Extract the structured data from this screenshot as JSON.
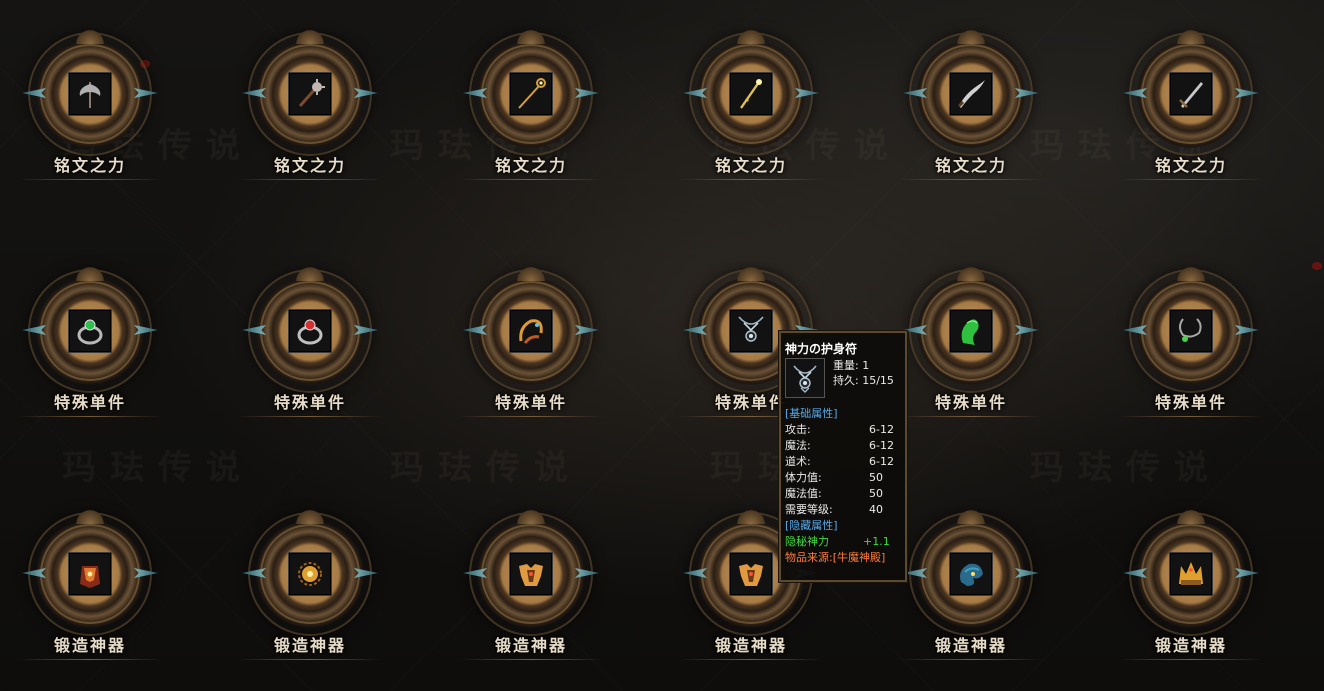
{
  "watermark_text": "玛珐传说",
  "rows": [
    {
      "label": "铭文之力",
      "items": [
        {
          "icon": "double-axe-icon",
          "color": "#b0b0b0"
        },
        {
          "icon": "spiked-mace-icon",
          "color": "#c0b8b0"
        },
        {
          "icon": "golden-staff-icon",
          "color": "#d7a13a"
        },
        {
          "icon": "golden-wand-icon",
          "color": "#e0c050"
        },
        {
          "icon": "curved-blade-icon",
          "color": "#d0d0d0"
        },
        {
          "icon": "long-sword-icon",
          "color": "#c8c8c8"
        }
      ]
    },
    {
      "label": "特殊单件",
      "items": [
        {
          "icon": "green-gem-ring-icon",
          "color": "#2fbf4f"
        },
        {
          "icon": "red-gem-ring-icon",
          "color": "#d83030"
        },
        {
          "icon": "golden-bracelet-icon",
          "color": "#e09a30"
        },
        {
          "icon": "amulet-icon",
          "color": "#9fb8c8"
        },
        {
          "icon": "green-jade-icon",
          "color": "#30c040"
        },
        {
          "icon": "green-necklace-icon",
          "color": "#4ad04a"
        }
      ]
    },
    {
      "label": "锻造神器",
      "items": [
        {
          "icon": "red-gold-armor-icon",
          "color": "#e07a30"
        },
        {
          "icon": "sun-medallion-icon",
          "color": "#e0a030"
        },
        {
          "icon": "golden-chest-armor-icon",
          "color": "#e09a40"
        },
        {
          "icon": "golden-chest-armor-icon",
          "color": "#e09a40"
        },
        {
          "icon": "dragon-helm-icon",
          "color": "#40a0c0"
        },
        {
          "icon": "crown-helm-icon",
          "color": "#e0a030"
        }
      ]
    }
  ],
  "tooltip": {
    "title": "神力の护身符",
    "weight_label": "重量:",
    "weight_value": "1",
    "durability_label": "持久:",
    "durability_value": "15/15",
    "base_section": "[基础属性]",
    "base_stats": [
      {
        "k": "攻击:",
        "v": "6-12"
      },
      {
        "k": "魔法:",
        "v": "6-12"
      },
      {
        "k": "道术:",
        "v": "6-12"
      },
      {
        "k": "体力值:",
        "v": "50"
      },
      {
        "k": "魔法值:",
        "v": "50"
      },
      {
        "k": "需要等级:",
        "v": "40"
      }
    ],
    "hidden_section": "[隐藏属性]",
    "hidden_stat": {
      "k": "隐秘神力",
      "v": "+1.1"
    },
    "source": "物品来源:[牛魔神殿]",
    "colors": {
      "title": "#ffffff",
      "section": "#58a8e8",
      "hidden": "#3ddc3d",
      "source": "#ff7a3a"
    }
  }
}
